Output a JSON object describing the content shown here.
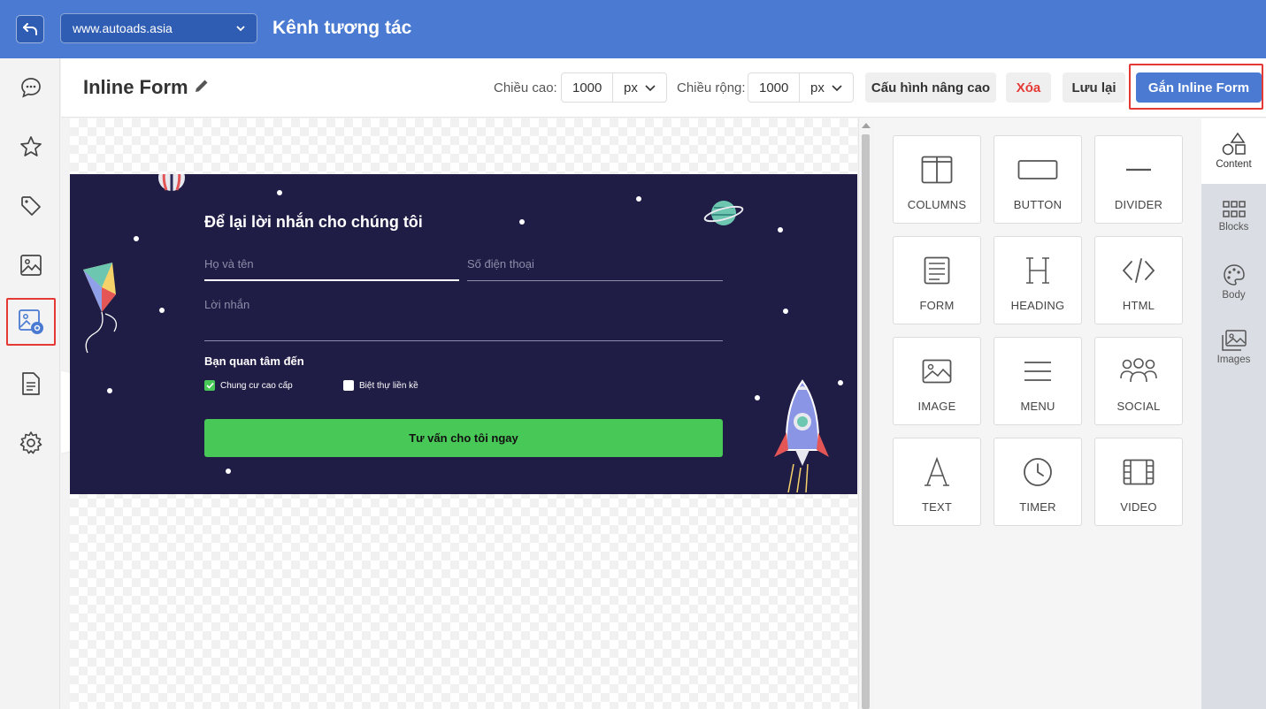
{
  "topbar": {
    "site": "www.autoads.asia",
    "title": "Kênh tương tác"
  },
  "header": {
    "form_title": "Inline Form",
    "height_label": "Chiều cao:",
    "height_value": "1000",
    "height_unit": "px",
    "width_label": "Chiều rộng:",
    "width_value": "1000",
    "width_unit": "px",
    "advanced_label": "Cấu hình nâng cao",
    "delete_label": "Xóa",
    "save_label": "Lưu lại",
    "attach_label": "Gắn Inline Form"
  },
  "banner": {
    "title": "Để lại lời nhắn cho chúng tôi",
    "name_placeholder": "Họ và tên",
    "phone_placeholder": "Số điện thoại",
    "message_placeholder": "Lời nhắn",
    "interest_label": "Bạn quan tâm đến",
    "options": [
      {
        "label": "Chung cư cao cấp",
        "checked": true
      },
      {
        "label": "Biệt thự liền kề",
        "checked": false
      }
    ],
    "submit_label": "Tư vấn cho tôi ngay"
  },
  "content_tools": [
    {
      "label": "COLUMNS",
      "icon": "columns-icon"
    },
    {
      "label": "BUTTON",
      "icon": "button-icon"
    },
    {
      "label": "DIVIDER",
      "icon": "divider-icon"
    },
    {
      "label": "FORM",
      "icon": "form-icon"
    },
    {
      "label": "HEADING",
      "icon": "heading-icon"
    },
    {
      "label": "HTML",
      "icon": "html-icon"
    },
    {
      "label": "IMAGE",
      "icon": "image-icon"
    },
    {
      "label": "MENU",
      "icon": "menu-icon"
    },
    {
      "label": "SOCIAL",
      "icon": "social-icon"
    },
    {
      "label": "TEXT",
      "icon": "text-icon"
    },
    {
      "label": "TIMER",
      "icon": "timer-icon"
    },
    {
      "label": "VIDEO",
      "icon": "video-icon"
    }
  ],
  "right_tabs": [
    {
      "label": "Content",
      "icon": "shapes-icon",
      "active": true
    },
    {
      "label": "Blocks",
      "icon": "grid-icon",
      "active": false
    },
    {
      "label": "Body",
      "icon": "palette-icon",
      "active": false
    },
    {
      "label": "Images",
      "icon": "images-icon",
      "active": false
    }
  ],
  "sidebar": [
    "chat-icon",
    "star-icon",
    "tag-icon",
    "image-icon",
    "image-gear-icon",
    "document-icon",
    "gear-icon"
  ],
  "colors": {
    "brand": "#4a7ad1",
    "danger": "#e53935",
    "banner_bg": "#1f1c45",
    "submit_bg": "#48c856"
  }
}
